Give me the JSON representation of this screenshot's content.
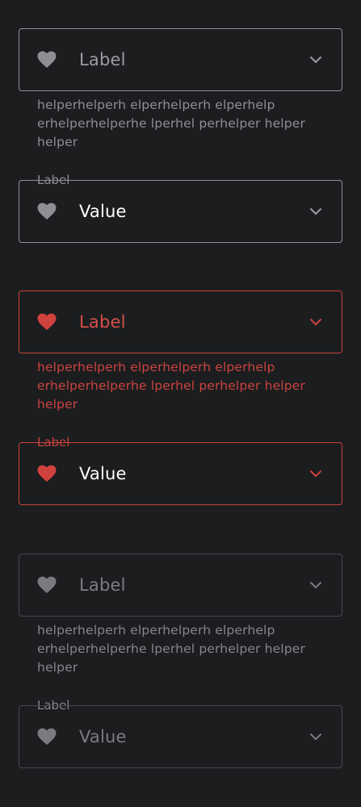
{
  "colors": {
    "background": "#1c1d1f",
    "default_border": "#8f9094",
    "default_icon": "#8e8f95",
    "error": "#c9433f",
    "disabled_border": "#48494d",
    "disabled_icon": "#7a7b80",
    "value_text": "#ffffff"
  },
  "icons": {
    "leading": "heart-icon",
    "trailing": "chevron-down-icon"
  },
  "groups": {
    "default": {
      "empty_field": {
        "placeholder": "Label"
      },
      "helper_text": "helperhelperh elperhelperh elperhelp erhelperhelperhe lperhel perhelper helper helper",
      "filled_field": {
        "label": "Label",
        "value": "Value"
      }
    },
    "error": {
      "empty_field": {
        "placeholder": "Label"
      },
      "helper_text": "helperhelperh elperhelperh elperhelp erhelperhelperhe lperhel perhelper helper helper",
      "filled_field": {
        "label": "Label",
        "value": "Value"
      }
    },
    "disabled": {
      "empty_field": {
        "placeholder": "Label"
      },
      "helper_text": "helperhelperh elperhelperh elperhelp erhelperhelperhe lperhel perhelper helper helper",
      "filled_field": {
        "label": "Label",
        "value": "Value"
      }
    }
  }
}
